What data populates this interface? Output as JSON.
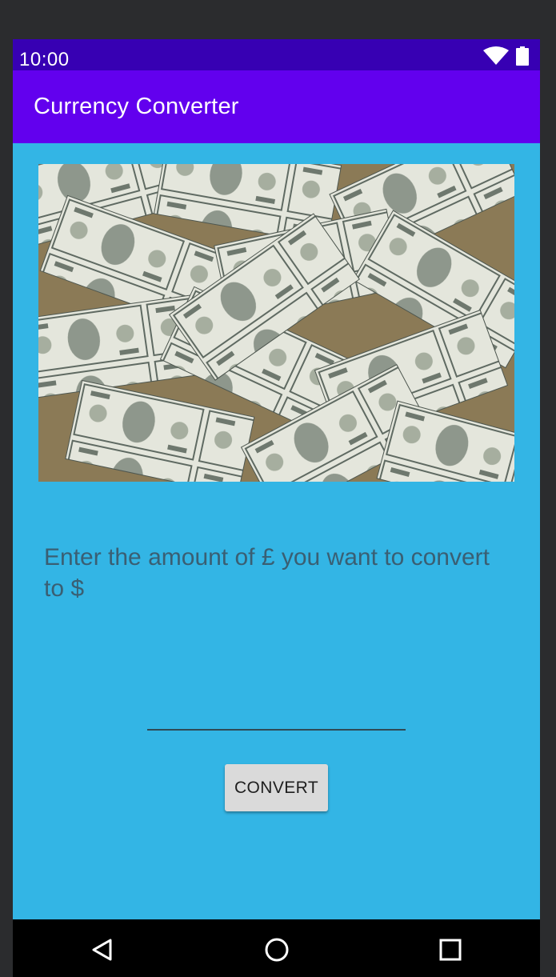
{
  "status_bar": {
    "time": "10:00",
    "icons": [
      "wifi-icon",
      "battery-icon"
    ]
  },
  "app_bar": {
    "title": "Currency Converter"
  },
  "main": {
    "banner_image": "pile-of-dollar-bills",
    "prompt": "Enter the amount of £ you want to convert to $",
    "amount_input": {
      "value": "",
      "placeholder": ""
    },
    "convert_button": "CONVERT"
  },
  "nav_bar": {
    "items": [
      "back-icon",
      "home-icon",
      "recents-icon"
    ]
  },
  "colors": {
    "status_bar": "#3700b3",
    "app_bar": "#6200ee",
    "background": "#33b5e5",
    "prompt_text": "#3a5f73",
    "button": "#dadada",
    "nav_bar": "#000000"
  }
}
